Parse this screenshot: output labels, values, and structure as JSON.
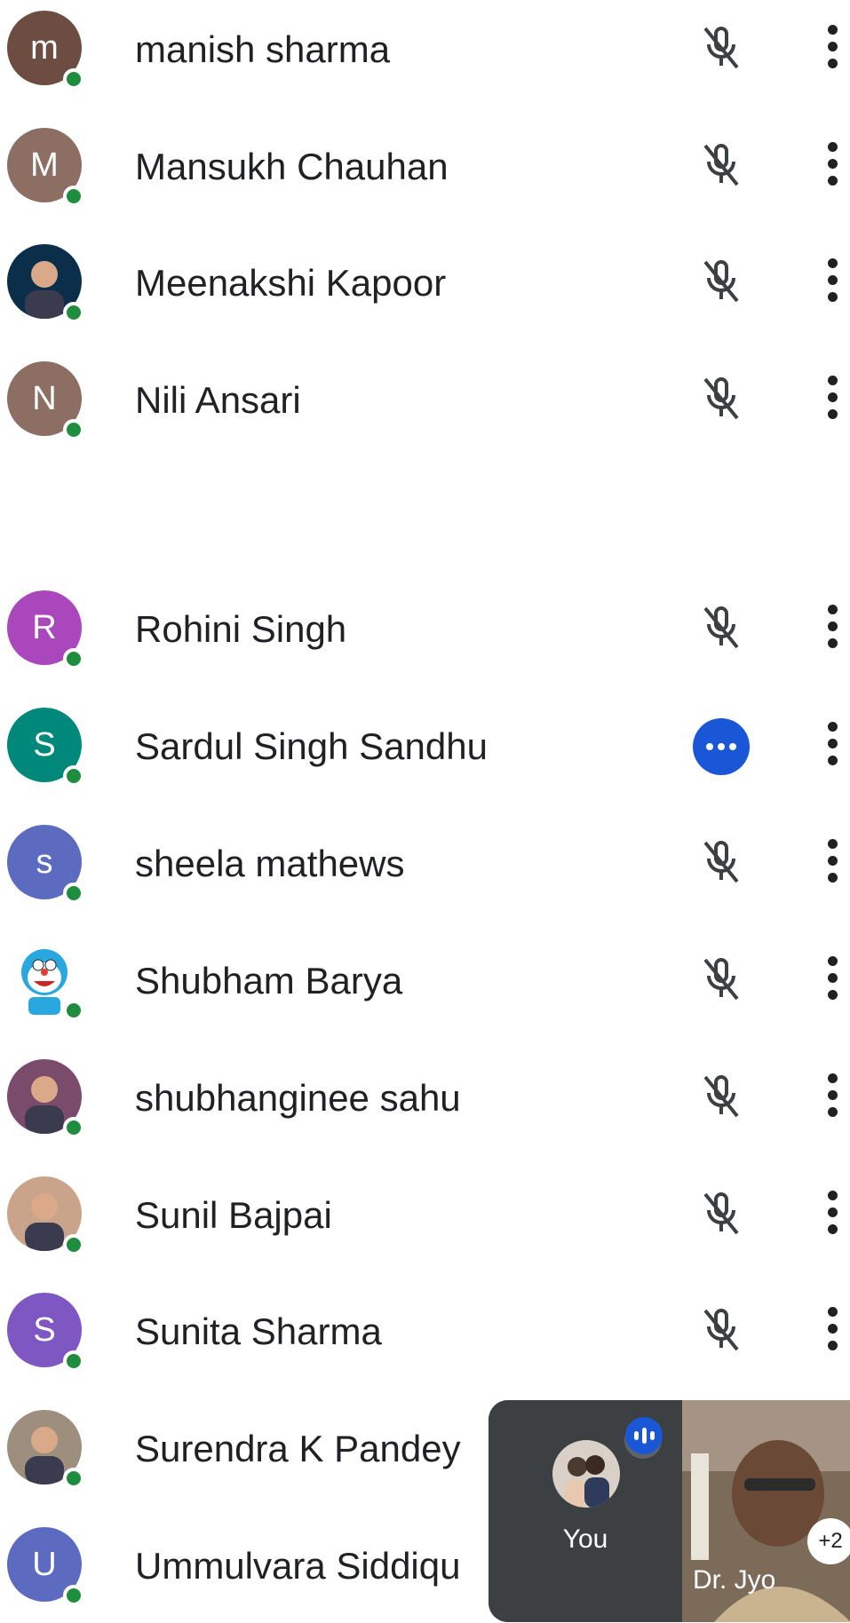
{
  "participants": [
    {
      "name": "manish sharma",
      "initial": "m",
      "avatar_color": "#6d4c41",
      "avatar_type": "letter",
      "status": "muted"
    },
    {
      "name": "Mansukh Chauhan",
      "initial": "M",
      "avatar_color": "#8d6e63",
      "avatar_type": "letter",
      "status": "muted"
    },
    {
      "name": "Meenakshi Kapoor",
      "initial": "",
      "avatar_color": "#0b2f4a",
      "avatar_type": "photo",
      "status": "muted"
    },
    {
      "name": "Nili Ansari",
      "initial": "N",
      "avatar_color": "#8d6e63",
      "avatar_type": "letter",
      "status": "muted"
    },
    {
      "name": "Rohini Singh",
      "initial": "R",
      "avatar_color": "#ab47bc",
      "avatar_type": "letter",
      "status": "muted"
    },
    {
      "name": "Sardul Singh Sandhu",
      "initial": "S",
      "avatar_color": "#00897b",
      "avatar_type": "letter",
      "status": "more"
    },
    {
      "name": "sheela mathews",
      "initial": "s",
      "avatar_color": "#5c6bc0",
      "avatar_type": "letter",
      "status": "muted"
    },
    {
      "name": "Shubham Barya",
      "initial": "",
      "avatar_color": "#29a8e0",
      "avatar_type": "cartoon",
      "status": "muted"
    },
    {
      "name": "shubhanginee sahu",
      "initial": "",
      "avatar_color": "#7b4b6b",
      "avatar_type": "photo",
      "status": "muted"
    },
    {
      "name": "Sunil Bajpai",
      "initial": "",
      "avatar_color": "#c9a48a",
      "avatar_type": "photo",
      "status": "muted"
    },
    {
      "name": "Sunita Sharma",
      "initial": "S",
      "avatar_color": "#7e57c2",
      "avatar_type": "letter",
      "status": "muted"
    },
    {
      "name": "Surendra K Pandey",
      "initial": "",
      "avatar_color": "#9e8e7e",
      "avatar_type": "photo",
      "status": "muted"
    },
    {
      "name": "Ummulvara Siddiqu",
      "initial": "U",
      "avatar_color": "#5c6bc0",
      "avatar_type": "letter",
      "status": "muted"
    }
  ],
  "icons": {
    "mic_off": "mic-off-icon",
    "more": "more-vert-icon",
    "busy": "more-horiz-icon"
  },
  "pip": {
    "self_label": "You",
    "remote_label": "Dr. Jyo",
    "extra_count": "+2"
  }
}
